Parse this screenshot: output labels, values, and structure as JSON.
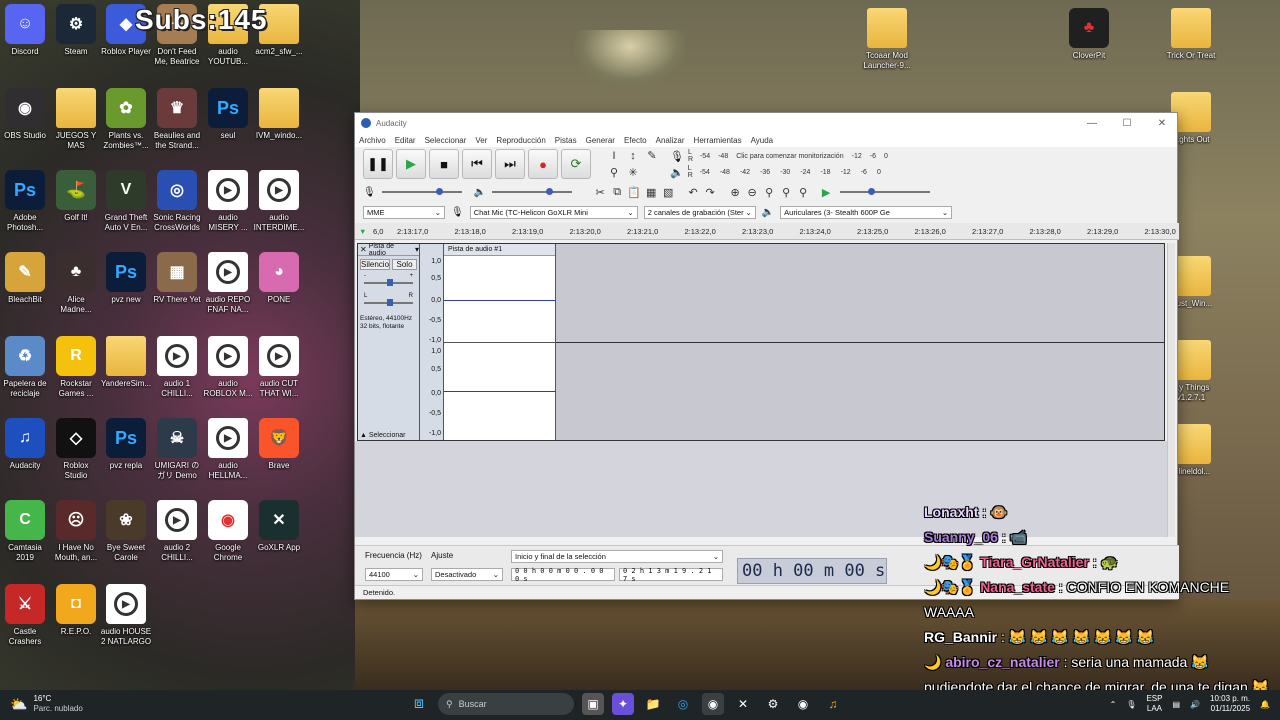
{
  "subs_overlay": "Subs:145",
  "desktop_icons": [
    {
      "label": "Discord",
      "icon": "discord-icon",
      "color": "#5865f2",
      "glyph": "☺"
    },
    {
      "label": "Steam",
      "icon": "steam-icon",
      "color": "#1b2838",
      "glyph": "⚙"
    },
    {
      "label": "Roblox Player",
      "icon": "roblox-icon",
      "color": "#3b5bdb",
      "glyph": "◆"
    },
    {
      "label": "Don't Feed\nMe, Beatrice",
      "icon": "game-icon",
      "color": "#a67c52",
      "glyph": "✦"
    },
    {
      "label": "audio\nYOUTUB...",
      "icon": "folder-icon",
      "color": "",
      "glyph": ""
    },
    {
      "label": "acm2_sfw_...",
      "icon": "folder-icon",
      "color": "",
      "glyph": ""
    },
    {
      "label": "OBS Studio",
      "icon": "obs-icon",
      "color": "#302e31",
      "glyph": "◉"
    },
    {
      "label": "JUEGOS Y\nMAS",
      "icon": "folder-icon",
      "color": "",
      "glyph": ""
    },
    {
      "label": "Plants vs.\nZombies™...",
      "icon": "pvz-icon",
      "color": "#6a9a2e",
      "glyph": "✿"
    },
    {
      "label": "Beaulies and\nthe Strand...",
      "icon": "game-icon",
      "color": "#6b3a3a",
      "glyph": "♛"
    },
    {
      "label": "seul",
      "icon": "photoshop-icon",
      "color": "",
      "glyph": "Ps"
    },
    {
      "label": "IVM_windo...",
      "icon": "folder-icon",
      "color": "",
      "glyph": ""
    },
    {
      "label": "Adobe\nPhotosh...",
      "icon": "photoshop-icon",
      "color": "",
      "glyph": "Ps"
    },
    {
      "label": "Golf It!",
      "icon": "golf-icon",
      "color": "#3b5e3a",
      "glyph": "⛳"
    },
    {
      "label": "Grand Theft\nAuto V En...",
      "icon": "gta-icon",
      "color": "#2e3b2a",
      "glyph": "V"
    },
    {
      "label": "Sonic Racing\nCrossWorlds",
      "icon": "sonic-icon",
      "color": "#2a4fb3",
      "glyph": "◎"
    },
    {
      "label": "audio\nMISERY ...",
      "icon": "audio-file-icon",
      "color": "",
      "glyph": "▶"
    },
    {
      "label": "audio\nINTERDIME...",
      "icon": "audio-file-icon",
      "color": "",
      "glyph": "▶"
    },
    {
      "label": "BleachBit",
      "icon": "bleachbit-icon",
      "color": "#d6a43a",
      "glyph": "✎"
    },
    {
      "label": "Alice\nMadne...",
      "icon": "game-icon",
      "color": "#3a2e2e",
      "glyph": "♣"
    },
    {
      "label": "pvz new",
      "icon": "photoshop-icon",
      "color": "",
      "glyph": "Ps"
    },
    {
      "label": "RV There Yet",
      "icon": "game-icon",
      "color": "#8a6a4a",
      "glyph": "▦"
    },
    {
      "label": "audio REPO\nFNAF NA...",
      "icon": "audio-file-icon",
      "color": "",
      "glyph": "▶"
    },
    {
      "label": "PONE",
      "icon": "game-icon",
      "color": "#d86ab0",
      "glyph": "◕"
    },
    {
      "label": "Papelera de\nreciclaje",
      "icon": "recycle-bin-icon",
      "color": "#5a8ac8",
      "glyph": "♻"
    },
    {
      "label": "Rockstar\nGames ...",
      "icon": "rockstar-icon",
      "color": "#f4c20d",
      "glyph": "R"
    },
    {
      "label": "YandereSim...",
      "icon": "folder-icon",
      "color": "",
      "glyph": ""
    },
    {
      "label": "audio 1\nCHILLI...",
      "icon": "audio-file-icon",
      "color": "",
      "glyph": "▶"
    },
    {
      "label": "audio\nROBLOX M...",
      "icon": "audio-file-icon",
      "color": "",
      "glyph": "▶"
    },
    {
      "label": "audio CUT\nTHAT WI...",
      "icon": "audio-file-icon",
      "color": "",
      "glyph": "▶"
    },
    {
      "label": "Audacity",
      "icon": "audacity-icon",
      "color": "#1e4fbf",
      "glyph": "♫"
    },
    {
      "label": "Roblox\nStudio",
      "icon": "roblox-studio-icon",
      "color": "#111",
      "glyph": "◇"
    },
    {
      "label": "pvz repla",
      "icon": "photoshop-icon",
      "color": "",
      "glyph": "Ps"
    },
    {
      "label": "UMIGARI の\nガリ Demo",
      "icon": "game-icon",
      "color": "#2c3a4a",
      "glyph": "☠"
    },
    {
      "label": "audio\nHELLMA...",
      "icon": "audio-file-icon",
      "color": "",
      "glyph": "▶"
    },
    {
      "label": "Brave",
      "icon": "brave-icon",
      "color": "#fb542b",
      "glyph": "🦁"
    },
    {
      "label": "Camtasia\n2019",
      "icon": "camtasia-icon",
      "color": "#45b649",
      "glyph": "C"
    },
    {
      "label": "I Have No\nMouth, an...",
      "icon": "game-icon",
      "color": "#5a2a2a",
      "glyph": "☹"
    },
    {
      "label": "Bye Sweet\nCarole",
      "icon": "game-icon",
      "color": "#4a3a2a",
      "glyph": "❀"
    },
    {
      "label": "audio 2\nCHILLI...",
      "icon": "audio-file-icon",
      "color": "",
      "glyph": "▶"
    },
    {
      "label": "Google\nChrome",
      "icon": "chrome-icon",
      "color": "#ffffff",
      "glyph": "◉"
    },
    {
      "label": "GoXLR App",
      "icon": "goxlr-icon",
      "color": "#1a2f2f",
      "glyph": "✕"
    },
    {
      "label": "Castle\nCrashers",
      "icon": "game-icon",
      "color": "#c62828",
      "glyph": "⚔"
    },
    {
      "label": "R.E.P.O.",
      "icon": "game-icon",
      "color": "#f2a81d",
      "glyph": "◘"
    },
    {
      "label": "audio HOUSE\n2 NATLARGO",
      "icon": "audio-file-icon",
      "color": "",
      "glyph": "▶"
    }
  ],
  "right_icons": [
    {
      "label": "Tcoaar Mod\nLauncher-9...",
      "icon": "folder-icon"
    },
    {
      "label": "CloverPit",
      "icon": "cloverpit-icon"
    },
    {
      "label": "Trick Or Treat",
      "icon": "folder-icon"
    },
    {
      "label": "...ghts Out",
      "icon": "folder-icon"
    },
    {
      "label": "...ust_Win...",
      "icon": "folder-icon"
    },
    {
      "label": "...y Things\nv1.2.7.1",
      "icon": "folder-icon"
    },
    {
      "label": "...lineldol...",
      "icon": "folder-icon"
    }
  ],
  "audacity": {
    "window_title": "Audacity",
    "menu": [
      "Archivo",
      "Editar",
      "Seleccionar",
      "Ver",
      "Reproducción",
      "Pistas",
      "Generar",
      "Efecto",
      "Analizar",
      "Herramientas",
      "Ayuda"
    ],
    "meter_record_scale": [
      "-54",
      "-48",
      "Clic para comenzar monitorización",
      "-12",
      "-6",
      "0"
    ],
    "meter_play_scale": [
      "-54",
      "-48",
      "-42",
      "-36",
      "-30",
      "-24",
      "-18",
      "-12",
      "-6",
      "0"
    ],
    "host": "MME",
    "record_device": "Chat Mic (TC-Helicon GoXLR Mini",
    "channels": "2 canales de grabación (Ster",
    "playback_device": "Auriculares (3- Stealth 600P Ge",
    "ruler_ticks": [
      "2:13:17,0",
      "2:13:18,0",
      "2:13:19,0",
      "2:13:20,0",
      "2:13:21,0",
      "2:13:22,0",
      "2:13:23,0",
      "2:13:24,0",
      "2:13:25,0",
      "2:13:26,0",
      "2:13:27,0",
      "2:13:28,0",
      "2:13:29,0",
      "2:13:30,0"
    ],
    "ruler_start": "6,0",
    "track": {
      "name": "Pista de audio",
      "clip_name": "Pista de audio #1",
      "mute": "Silencio",
      "solo": "Solo",
      "gain_minus": "-",
      "gain_plus": "+",
      "pan_left": "L",
      "pan_right": "R",
      "info": "Estéreo, 44100Hz\n32 bits, flotante",
      "select": "Seleccionar",
      "scale": [
        "1,0",
        "0,5",
        "0,0",
        "-0,5",
        "-1,0",
        "1,0",
        "0,5",
        "0,0",
        "-0,5",
        "-1,0"
      ]
    },
    "rate_label": "Frecuencia (Hz)",
    "rate_value": "44100",
    "snap_label": "Ajuste",
    "snap_value": "Desactivado",
    "selection_mode": "Inicio y final de la selección",
    "sel_start": "0 0 h 0 0 m 0 0 . 0 0 0 s",
    "sel_end": "0 2 h 1 3 m 1 9 . 2 1 7 s",
    "big_time": "00 h 00 m 00 s",
    "status": "Detenido."
  },
  "chat": [
    {
      "badges": "",
      "user": "Lonaxht",
      "user_color": "#e8d4ff",
      "message": ": 🐵"
    },
    {
      "badges": "",
      "user": "Suanny_06",
      "user_color": "#a87fd8",
      "message": ": 📹"
    },
    {
      "badges": "🌙🎭🏅",
      "user": "Tiara_GrNatalier",
      "user_color": "#f06292",
      "message": ": 🐢"
    },
    {
      "badges": "🌙🎭🏅",
      "user": "Nana_state",
      "user_color": "#f06292",
      "message": ": CONFIO EN KOMANCHE WAAAA"
    },
    {
      "badges": "",
      "user": "RG_Bannir",
      "user_color": "#ffffff",
      "message": ": 😹 😹 😹 😹 😹 😹 😹"
    },
    {
      "badges": "🌙",
      "user": "abiro_cz_natalier",
      "user_color": "#c48be8",
      "message": ": seria una mamada 😹 pudiendote dar el chance de migrar, de una te digan 😹 ps de llano no"
    }
  ],
  "taskbar": {
    "temp": "16°C",
    "weather": "Parc. nublado",
    "search_placeholder": "Buscar",
    "lang": "ESP",
    "lang2": "LAA",
    "time": "10:03 p. m.",
    "date": "01/11/2025"
  }
}
